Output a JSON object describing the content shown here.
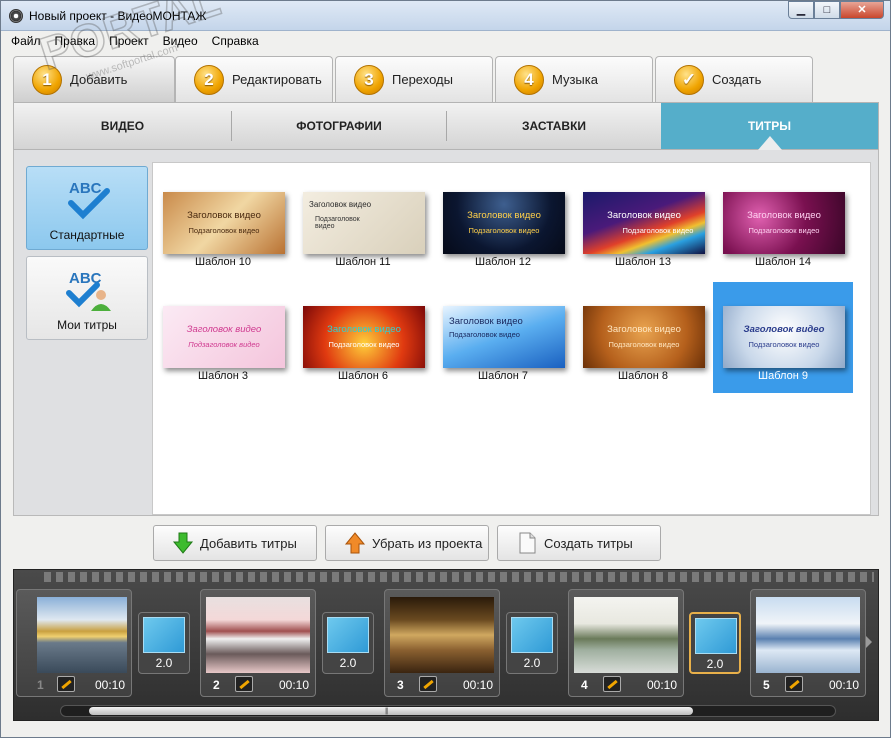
{
  "window": {
    "title": "Новый проект - ВидеоМОНТАЖ",
    "min": "▁",
    "max": "□",
    "close": "✕"
  },
  "menu": [
    "Файл",
    "Правка",
    "Проект",
    "Видео",
    "Справка"
  ],
  "steps": [
    {
      "num": "1",
      "label": "Добавить"
    },
    {
      "num": "2",
      "label": "Редактировать"
    },
    {
      "num": "3",
      "label": "Переходы"
    },
    {
      "num": "4",
      "label": "Музыка"
    },
    {
      "num": "✓",
      "label": "Создать"
    }
  ],
  "categories": [
    "ВИДЕО",
    "ФОТОГРАФИИ",
    "ЗАСТАВКИ",
    "ТИТРЫ"
  ],
  "sidebar": [
    {
      "label": "Стандартные",
      "icon": "abc-check-icon"
    },
    {
      "label": "Мои титры",
      "icon": "abc-user-icon"
    }
  ],
  "icon_text": "ABC",
  "templates": [
    {
      "label": "Шаблон 10",
      "t1": "Заголовок видео",
      "t2": "Подзаголовок видео"
    },
    {
      "label": "Шаблон 11",
      "t1": "Заголовок видео",
      "t2": "Подзаголовок видео"
    },
    {
      "label": "Шаблон 12",
      "t1": "Заголовок видео",
      "t2": "Подзаголовок видео"
    },
    {
      "label": "Шаблон 13",
      "t1": "Заголовок видео",
      "t2": "Подзаголовок видео"
    },
    {
      "label": "Шаблон 14",
      "t1": "Заголовок видео",
      "t2": "Подзаголовок видео"
    },
    {
      "label": "Шаблон 3",
      "t1": "Заголовок видео",
      "t2": "Подзаголовок видео"
    },
    {
      "label": "Шаблон 6",
      "t1": "Заголовок видео",
      "t2": "Подзаголовок видео"
    },
    {
      "label": "Шаблон 7",
      "t1": "Заголовок видео",
      "t2": "Подзаголовок видео"
    },
    {
      "label": "Шаблон 8",
      "t1": "Заголовок видео",
      "t2": "Подзаголовок видео"
    },
    {
      "label": "Шаблон 9",
      "t1": "Заголовок видео",
      "t2": "Подзаголовок видео"
    }
  ],
  "actions": {
    "add": "Добавить титры",
    "remove": "Убрать из проекта",
    "create": "Создать титры"
  },
  "timeline": {
    "clips": [
      {
        "num": "1",
        "dur": "00:10"
      },
      {
        "num": "2",
        "dur": "00:10"
      },
      {
        "num": "3",
        "dur": "00:10"
      },
      {
        "num": "4",
        "dur": "00:10"
      },
      {
        "num": "5",
        "dur": "00:10"
      }
    ],
    "transitions": [
      "2.0",
      "2.0",
      "2.0",
      "2.0"
    ],
    "scroll_grip": "|||"
  },
  "watermark": {
    "text": "PORTAL",
    "url": "www.softportal.com"
  },
  "colors": {
    "accent": "#55aeca",
    "selection": "#3a9bea",
    "badge": "#f0a400"
  }
}
